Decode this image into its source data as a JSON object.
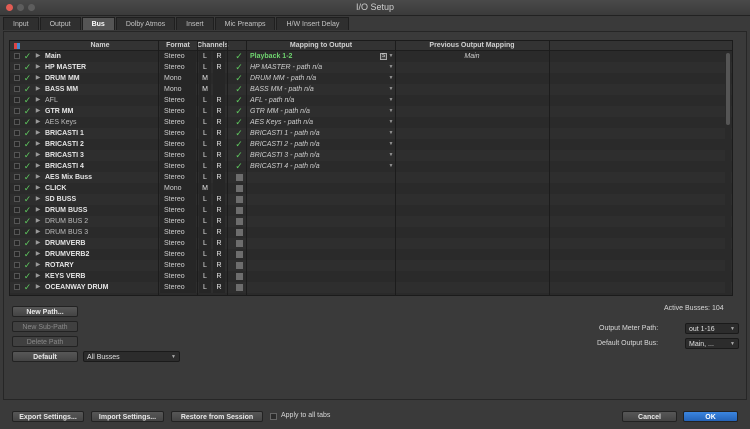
{
  "window": {
    "title": "I/O Setup"
  },
  "tabs": [
    {
      "label": "Input",
      "active": false
    },
    {
      "label": "Output",
      "active": false
    },
    {
      "label": "Bus",
      "active": true
    },
    {
      "label": "Dolby Atmos",
      "active": false
    },
    {
      "label": "Insert",
      "active": false
    },
    {
      "label": "Mic Preamps",
      "active": false
    },
    {
      "label": "H/W Insert Delay",
      "active": false
    }
  ],
  "columns": {
    "name": "Name",
    "format": "Format",
    "channels": "Channels",
    "mapping": "Mapping to Output",
    "previous": "Previous Output Mapping"
  },
  "rows": [
    {
      "name": "Main",
      "bold": true,
      "format": "Stereo",
      "ch": [
        "L",
        "R"
      ],
      "mapped": true,
      "mapping": "Playback 1-2",
      "previous": "Main"
    },
    {
      "name": "HP MASTER",
      "bold": true,
      "format": "Stereo",
      "ch": [
        "L",
        "R"
      ],
      "mapped": true,
      "mapping": "HP MASTER - path n/a",
      "previous": ""
    },
    {
      "name": "DRUM MM",
      "bold": true,
      "format": "Mono",
      "ch": [
        "M",
        ""
      ],
      "mapped": true,
      "mapping": "DRUM MM - path n/a",
      "previous": ""
    },
    {
      "name": "BASS MM",
      "bold": true,
      "format": "Mono",
      "ch": [
        "M",
        ""
      ],
      "mapped": true,
      "mapping": "BASS MM - path n/a",
      "previous": ""
    },
    {
      "name": "AFL",
      "bold": false,
      "format": "Stereo",
      "ch": [
        "L",
        "R"
      ],
      "mapped": true,
      "mapping": "AFL - path n/a",
      "previous": ""
    },
    {
      "name": "GTR MM",
      "bold": true,
      "format": "Stereo",
      "ch": [
        "L",
        "R"
      ],
      "mapped": true,
      "mapping": "GTR MM - path n/a",
      "previous": ""
    },
    {
      "name": "AES Keys",
      "bold": false,
      "format": "Stereo",
      "ch": [
        "L",
        "R"
      ],
      "mapped": true,
      "mapping": "AES Keys - path n/a",
      "previous": ""
    },
    {
      "name": "BRICASTI 1",
      "bold": true,
      "format": "Stereo",
      "ch": [
        "L",
        "R"
      ],
      "mapped": true,
      "mapping": "BRICASTI 1 - path n/a",
      "previous": ""
    },
    {
      "name": "BRICASTI 2",
      "bold": true,
      "format": "Stereo",
      "ch": [
        "L",
        "R"
      ],
      "mapped": true,
      "mapping": "BRICASTI 2 - path n/a",
      "previous": ""
    },
    {
      "name": "BRICASTI 3",
      "bold": true,
      "format": "Stereo",
      "ch": [
        "L",
        "R"
      ],
      "mapped": true,
      "mapping": "BRICASTI 3 - path n/a",
      "previous": ""
    },
    {
      "name": "BRICASTI 4",
      "bold": true,
      "format": "Stereo",
      "ch": [
        "L",
        "R"
      ],
      "mapped": true,
      "mapping": "BRICASTI 4 - path n/a",
      "previous": ""
    },
    {
      "name": "AES Mix Buss",
      "bold": true,
      "format": "Stereo",
      "ch": [
        "L",
        "R"
      ],
      "mapped": false,
      "mapping": "",
      "previous": ""
    },
    {
      "name": "CLICK",
      "bold": true,
      "format": "Mono",
      "ch": [
        "M",
        ""
      ],
      "mapped": false,
      "mapping": "",
      "previous": ""
    },
    {
      "name": "SD BUSS",
      "bold": true,
      "format": "Stereo",
      "ch": [
        "L",
        "R"
      ],
      "mapped": false,
      "mapping": "",
      "previous": ""
    },
    {
      "name": "DRUM BUSS",
      "bold": true,
      "format": "Stereo",
      "ch": [
        "L",
        "R"
      ],
      "mapped": false,
      "mapping": "",
      "previous": ""
    },
    {
      "name": "DRUM BUS 2",
      "bold": false,
      "format": "Stereo",
      "ch": [
        "L",
        "R"
      ],
      "mapped": false,
      "mapping": "",
      "previous": ""
    },
    {
      "name": "DRUM BUS 3",
      "bold": false,
      "format": "Stereo",
      "ch": [
        "L",
        "R"
      ],
      "mapped": false,
      "mapping": "",
      "previous": ""
    },
    {
      "name": "DRUMVERB",
      "bold": true,
      "format": "Stereo",
      "ch": [
        "L",
        "R"
      ],
      "mapped": false,
      "mapping": "",
      "previous": ""
    },
    {
      "name": "DRUMVERB2",
      "bold": true,
      "format": "Stereo",
      "ch": [
        "L",
        "R"
      ],
      "mapped": false,
      "mapping": "",
      "previous": ""
    },
    {
      "name": "ROTARY",
      "bold": true,
      "format": "Stereo",
      "ch": [
        "L",
        "R"
      ],
      "mapped": false,
      "mapping": "",
      "previous": ""
    },
    {
      "name": "KEYS VERB",
      "bold": true,
      "format": "Stereo",
      "ch": [
        "L",
        "R"
      ],
      "mapped": false,
      "mapping": "",
      "previous": ""
    },
    {
      "name": "OCEANWAY DRUM",
      "bold": true,
      "format": "Stereo",
      "ch": [
        "L",
        "R"
      ],
      "mapped": false,
      "mapping": "",
      "previous": ""
    }
  ],
  "buttons": {
    "new_path": "New Path...",
    "new_sub_path": "New Sub-Path",
    "delete_path": "Delete Path",
    "default": "Default",
    "export": "Export Settings...",
    "import": "Import Settings...",
    "restore": "Restore from Session",
    "cancel": "Cancel",
    "ok": "OK"
  },
  "filter": {
    "selected": "All Busses"
  },
  "active_busses": {
    "label": "Active Busses:",
    "value": "104"
  },
  "output_meter_path": {
    "label": "Output Meter Path:",
    "value": "out 1-16"
  },
  "default_output_bus": {
    "label": "Default Output Bus:",
    "value": "Main, ..."
  },
  "apply_all_tabs": {
    "label": "Apply to all tabs",
    "checked": false
  },
  "colors": {
    "check": "#5fc95f",
    "ok": "#2f74d0",
    "mapping_active": "#6ed36e"
  }
}
